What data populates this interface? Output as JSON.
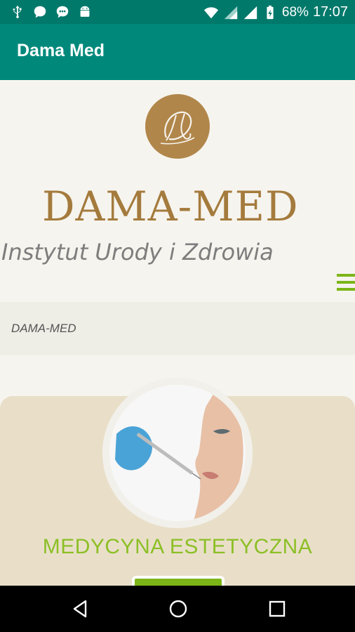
{
  "status_bar": {
    "battery": "68%",
    "time": "17:07",
    "icons": [
      "usb-icon",
      "chat-icon",
      "message-icon",
      "android-icon",
      "wifi-icon",
      "signal-icon",
      "battery-icon"
    ]
  },
  "app_bar": {
    "title": "Dama Med"
  },
  "header": {
    "brand": "DAMA-MED",
    "tagline": "Instytut Urody i Zdrowia"
  },
  "breadcrumb": {
    "label": "DAMA-MED"
  },
  "card": {
    "title": "MEDYCYNA ESTETYCZNA"
  },
  "colors": {
    "status_bar": "#00796b",
    "app_bar": "#00897b",
    "gold": "#a47b3d",
    "green": "#7cb518"
  },
  "nav_bar": {
    "icons": [
      "back-icon",
      "home-icon",
      "recents-icon"
    ]
  }
}
